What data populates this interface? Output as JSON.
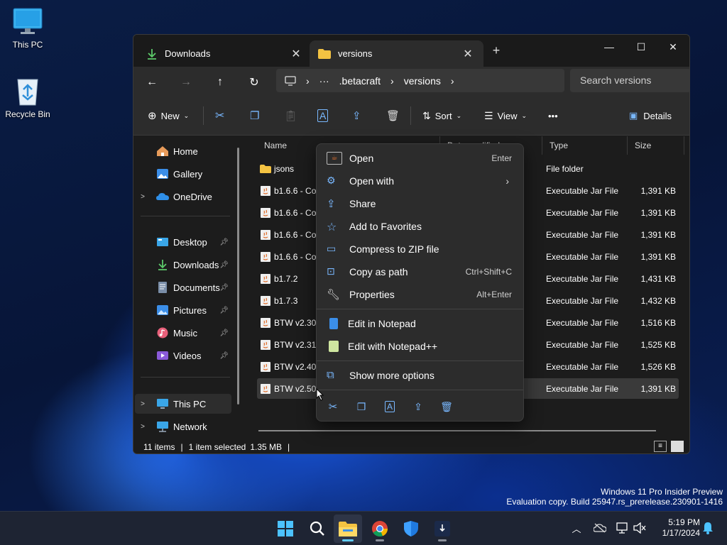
{
  "desktop": {
    "icons": [
      {
        "label": "This PC"
      },
      {
        "label": "Recycle Bin"
      }
    ],
    "watermark": {
      "line1": "Windows 11 Pro Insider Preview",
      "line2": "Evaluation copy. Build 25947.rs_prerelease.230901-1416"
    }
  },
  "explorer": {
    "tabs": [
      {
        "label": "Downloads",
        "icon": "download-icon"
      },
      {
        "label": "versions",
        "icon": "folder-icon"
      }
    ],
    "new_tab_glyph": "+",
    "window_controls": {
      "minimize": "—",
      "maximize": "☐",
      "close": "✕"
    },
    "breadcrumb": [
      ".betacraft",
      "versions"
    ],
    "breadcrumb_more": "···",
    "search_placeholder": "Search versions",
    "commands": {
      "new": "New",
      "sort": "Sort",
      "view": "View",
      "more": "•••",
      "details": "Details"
    },
    "sidebar": {
      "items": [
        {
          "label": "Home",
          "icon": "home-icon"
        },
        {
          "label": "Gallery",
          "icon": "gallery-icon"
        },
        {
          "label": "OneDrive",
          "icon": "onedrive-icon"
        },
        {
          "label": "Desktop",
          "icon": "desktop-icon"
        },
        {
          "label": "Downloads",
          "icon": "download-icon"
        },
        {
          "label": "Documents",
          "icon": "documents-icon"
        },
        {
          "label": "Pictures",
          "icon": "pictures-icon"
        },
        {
          "label": "Music",
          "icon": "music-icon"
        },
        {
          "label": "Videos",
          "icon": "videos-icon"
        },
        {
          "label": "This PC",
          "icon": "pc-icon"
        },
        {
          "label": "Network",
          "icon": "network-icon"
        }
      ]
    },
    "columns": [
      "Name",
      "Date modified",
      "Type",
      "Size"
    ],
    "files": [
      {
        "name": "jsons",
        "type": "File folder",
        "size": ""
      },
      {
        "name": "b1.6.6 - Cop",
        "type": "Executable Jar File",
        "size": "1,391 KB"
      },
      {
        "name": "b1.6.6 - Cop",
        "type": "Executable Jar File",
        "size": "1,391 KB"
      },
      {
        "name": "b1.6.6 - Cop",
        "type": "Executable Jar File",
        "size": "1,391 KB"
      },
      {
        "name": "b1.6.6 - Cop",
        "type": "Executable Jar File",
        "size": "1,391 KB"
      },
      {
        "name": "b1.7.2",
        "type": "Executable Jar File",
        "size": "1,431 KB"
      },
      {
        "name": "b1.7.3",
        "type": "Executable Jar File",
        "size": "1,432 KB"
      },
      {
        "name": "BTW v2.30",
        "type": "Executable Jar File",
        "size": "1,516 KB"
      },
      {
        "name": "BTW v2.31",
        "type": "Executable Jar File",
        "size": "1,525 KB"
      },
      {
        "name": "BTW v2.40",
        "type": "Executable Jar File",
        "size": "1,526 KB"
      },
      {
        "name": "BTW v2.50",
        "type": "Executable Jar File",
        "size": "1,391 KB"
      }
    ],
    "status": {
      "items": "11 items",
      "selected": "1 item selected",
      "size": "1.35 MB"
    }
  },
  "context_menu": {
    "items": [
      {
        "label": "Open",
        "shortcut": "Enter"
      },
      {
        "label": "Open with",
        "shortcut": "›"
      },
      {
        "label": "Share",
        "shortcut": ""
      },
      {
        "label": "Add to Favorites",
        "shortcut": ""
      },
      {
        "label": "Compress to ZIP file",
        "shortcut": ""
      },
      {
        "label": "Copy as path",
        "shortcut": "Ctrl+Shift+C"
      },
      {
        "label": "Properties",
        "shortcut": "Alt+Enter"
      },
      {
        "label": "Edit in Notepad",
        "shortcut": ""
      },
      {
        "label": "Edit with Notepad++",
        "shortcut": ""
      },
      {
        "label": "Show more options",
        "shortcut": ""
      }
    ]
  },
  "taskbar": {
    "clock_time": "5:19 PM",
    "clock_date": "1/17/2024"
  },
  "colors": {
    "accent": "#60cdff",
    "folder": "#f4c342",
    "window_bg": "#1c1c1c"
  }
}
